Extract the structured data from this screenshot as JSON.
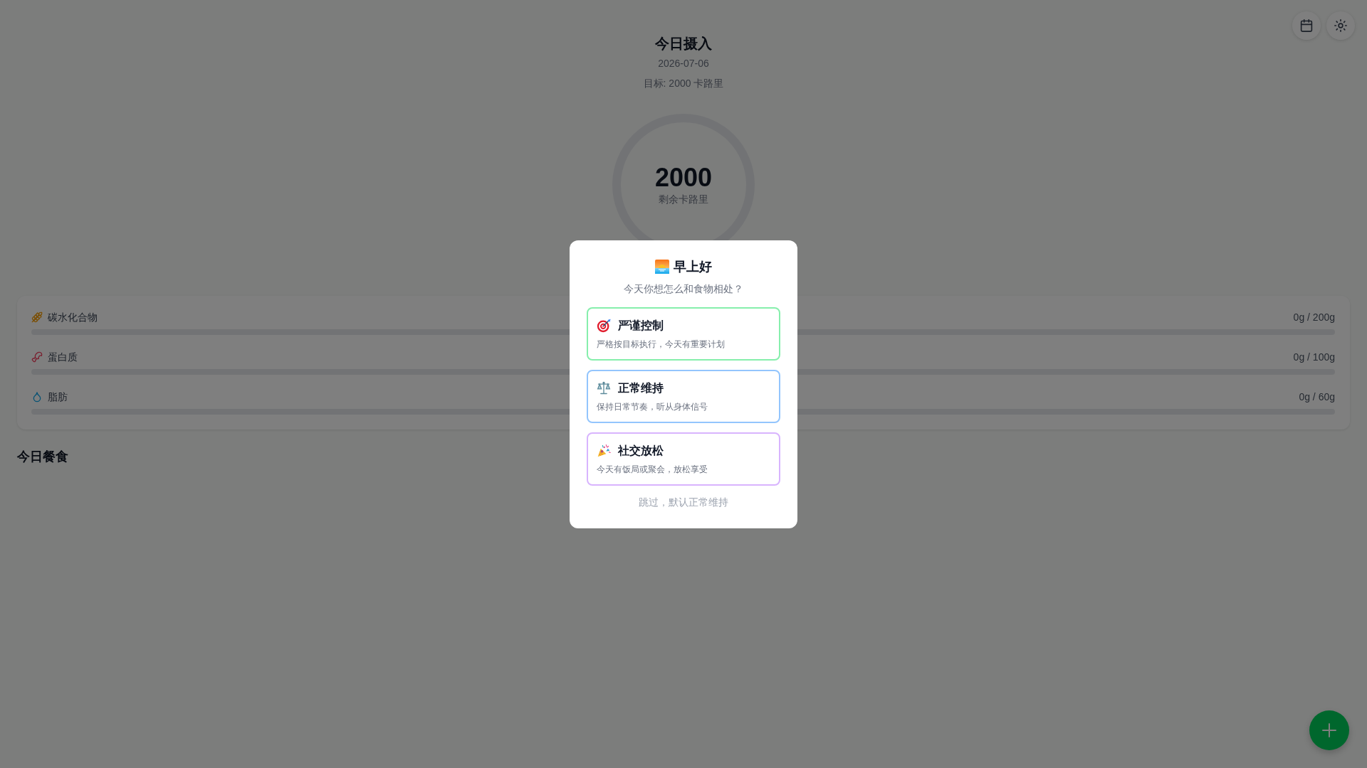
{
  "header": {
    "title": "今日摄入",
    "date": "2026-07-06",
    "goal": "目标: 2000 卡路里"
  },
  "calorie_ring": {
    "value": "2000",
    "label": "剩余卡路里"
  },
  "macros": [
    {
      "kind": "carbs",
      "name": "碳水化合物",
      "reading": "0g / 200g"
    },
    {
      "kind": "protein",
      "name": "蛋白质",
      "reading": "0g / 100g"
    },
    {
      "kind": "fat",
      "name": "脂肪",
      "reading": "0g / 60g"
    }
  ],
  "meals_heading": "今日餐食",
  "mood_dialog": {
    "title": "早上好",
    "subtitle": "今天你想怎么和食物相处？",
    "options": [
      {
        "kind": "strict",
        "title": "严谨控制",
        "description": "严格按目标执行，今天有重要计划",
        "color": "#86efac"
      },
      {
        "kind": "normal",
        "title": "正常维持",
        "description": "保持日常节奏，听从身体信号",
        "color": "#93c5fd"
      },
      {
        "kind": "social",
        "title": "社交放松",
        "description": "今天有饭局或聚会，放松享受",
        "color": "#d8b4fe"
      }
    ],
    "skip": "跳过，默认正常维持"
  }
}
